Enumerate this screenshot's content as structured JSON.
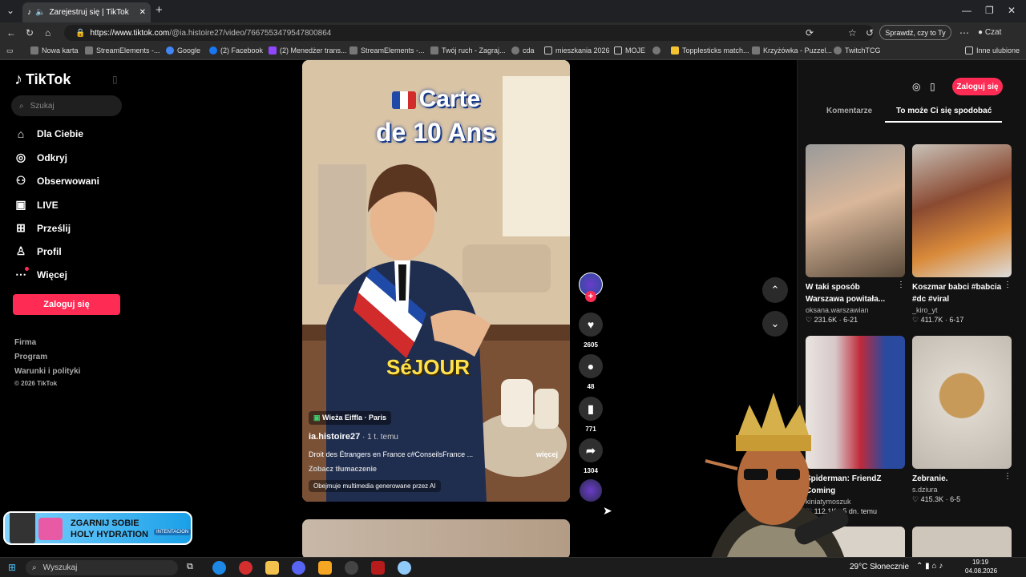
{
  "browser": {
    "tab_title": "Zarejestruj się | TikTok",
    "url_host": "https://www.tiktok.com",
    "url_path": "/@ia.histoire27/video/7667553479547800864",
    "check_pill": "Sprawdź, czy to Ty",
    "copilot": "Czat"
  },
  "bookmarks": [
    "Nowa karta",
    "StreamElements -...",
    "Google",
    "(2) Facebook",
    "(2) Menedżer trans...",
    "StreamElements -...",
    "Twój ruch - Zagraj...",
    "cda",
    "mieszkania 2026",
    "MOJE",
    "Topplesticks match...",
    "Krzyżówka - Puzzel...",
    "TwitchTCG",
    "Inne ulubione"
  ],
  "sidebar": {
    "logo": "TikTok",
    "search_placeholder": "Szukaj",
    "items": [
      "Dla Ciebie",
      "Odkryj",
      "Obserwowani",
      "LIVE",
      "Prześlij",
      "Profil",
      "Więcej"
    ],
    "login": "Zaloguj się",
    "footer": [
      "Firma",
      "Program",
      "Warunki i polityki",
      "© 2026 TikTok"
    ]
  },
  "video": {
    "title_line1": "Carte",
    "title_line2": "de 10 Ans",
    "overlay": "SéJOUR",
    "location": "Wieża Eiffla · Paris",
    "author": "ia.histoire27",
    "time": " · 1 t. temu",
    "desc": "Droit des Étrangers en France c#ConseilsFrance ...",
    "more": "więcej",
    "translation": "Zobacz tłumaczenie",
    "ai_label": "Obejmuje multimedia generowane przez AI"
  },
  "actions": {
    "likes": "2605",
    "comments": "48",
    "saves": "771",
    "shares": "1304"
  },
  "panel": {
    "login": "Zaloguj się",
    "tab_comments": "Komentarze",
    "tab_like": "To może Ci się spodobać",
    "cards": [
      {
        "title1": "W taki sposób",
        "title2": "Warszawa powitała...",
        "user": "oksana.warszawian",
        "stats": "♡ 231.6K · 6-21"
      },
      {
        "title1": "Koszmar babci #babcia",
        "title2": "#dc #viral",
        "user": "_kiro_yt",
        "stats": "♡ 411.7K · 6-17"
      },
      {
        "title1": "Spiderman: FriendZ",
        "title2": "Coming",
        "user": "kiniatymoszuk",
        "stats": "♡ 112.1K · 5 dn. temu"
      },
      {
        "title1": "Zebranie.",
        "title2": "",
        "user": "s.dziura",
        "stats": "♡ 415.3K · 6-5"
      }
    ]
  },
  "ad": {
    "line1": "ZGARNIJ SOBIE",
    "line2": "HOLY HYDRATION",
    "code": "INTENTACION"
  },
  "taskbar": {
    "search": "Wyszukaj",
    "weather": "29°C Słonecznie",
    "time": "19:19",
    "date": "04.08.2026"
  },
  "colors": {
    "brand": "#fe2c55"
  }
}
